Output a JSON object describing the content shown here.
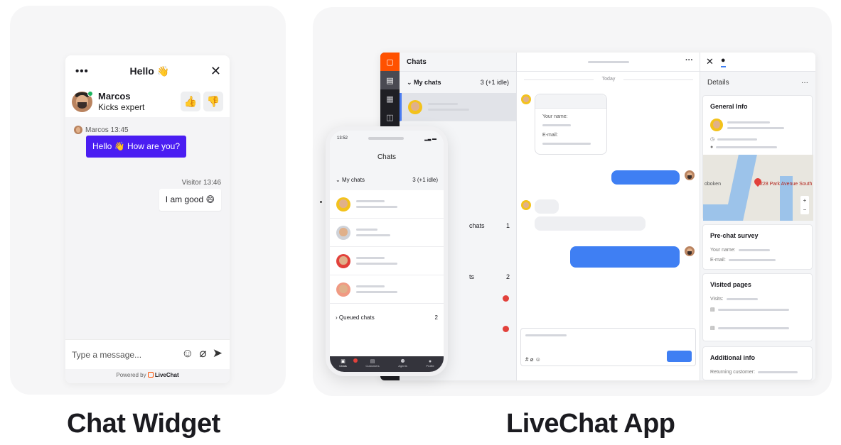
{
  "widget": {
    "menu_icon": "more-dots-icon",
    "title": "Hello 👋",
    "close_label": "✕",
    "agent": {
      "name": "Marcos",
      "role": "Kicks expert"
    },
    "rate_up": "👍",
    "rate_down": "👎",
    "messages": [
      {
        "from": "agent",
        "meta": "Marcos 13:45",
        "text": "Hello 👋 How are you?"
      },
      {
        "from": "visitor",
        "meta": "Visitor 13:46",
        "text": "I am good 😄"
      }
    ],
    "input_placeholder": "Type a message...",
    "tools": [
      "☺",
      "⌀",
      "➤"
    ],
    "powered_by": "Powered by",
    "brand": "LiveChat",
    "accent": "#4a1df2"
  },
  "app": {
    "chats_title": "Chats",
    "my_chats_label": "My chats",
    "my_chats_count": "3 (+1 idle)",
    "group_label_1": "chats",
    "group_count_1": "1",
    "group_label_2": "ts",
    "group_count_2": "2",
    "today_label": "Today",
    "form_name_label": "Your name:",
    "form_email_label": "E-mail:",
    "composer_tools": "# ⌀ ☺",
    "details_title": "Details",
    "details_menu": "···",
    "conv_menu": "···",
    "general_info": "General Info",
    "map_address": "228 Park Avenue South",
    "map_place": "oboken",
    "zoom_in": "+",
    "zoom_out": "−",
    "pre_chat_survey": "Pre-chat survey",
    "survey_name": "Your name:",
    "survey_email": "E-mail:",
    "visited_pages": "Visited pages",
    "visits_label": "Visits:",
    "additional_info": "Additional info",
    "returning_label": "Returning customer:",
    "brand_color": "#ff5100",
    "primary_blue": "#3f7ff3"
  },
  "phone": {
    "time": "13:52",
    "title": "Chats",
    "my_chats_label": "My chats",
    "my_chats_count": "3 (+1 idle)",
    "queued_label": "Queued chats",
    "queued_count": "2",
    "tabs": [
      "Chats",
      "Customers",
      "Agents",
      "Profile"
    ]
  },
  "captions": {
    "left": "Chat Widget",
    "right": "LiveChat App"
  }
}
